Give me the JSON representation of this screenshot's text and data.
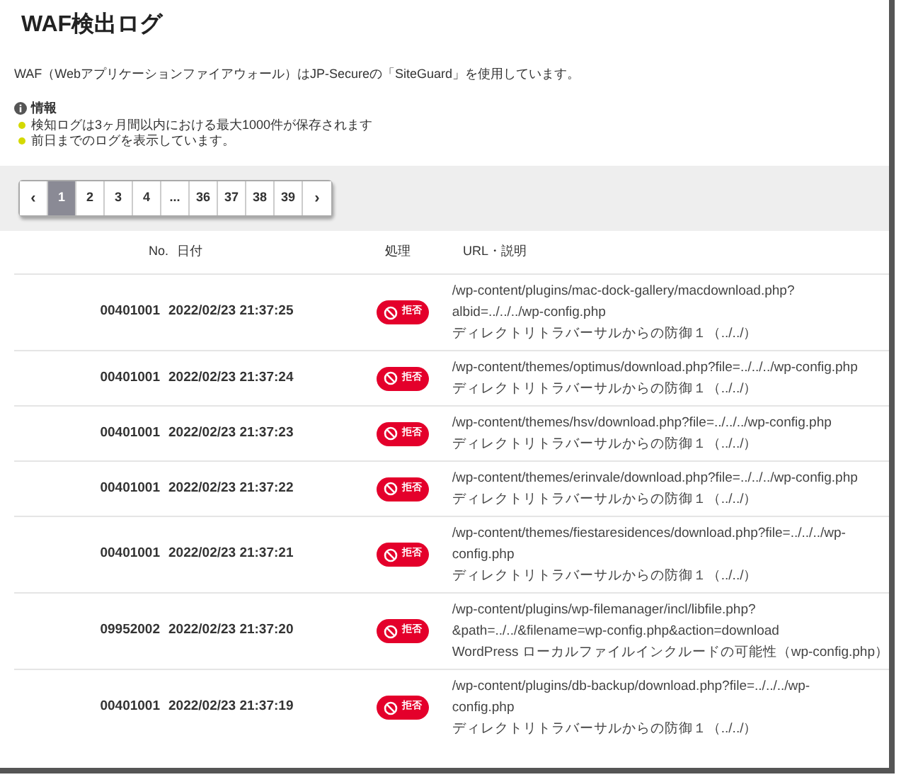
{
  "title": "WAF検出ログ",
  "description": "WAF（Webアプリケーションファイアウォール）はJP-Secureの「SiteGuard」を使用しています。",
  "info": {
    "heading": "情報",
    "items": [
      "検知ログは3ヶ月間以内における最大1000件が保存されます",
      "前日までのログを表示しています。"
    ]
  },
  "pagination": {
    "prev": "‹",
    "next": "›",
    "pages": [
      {
        "label": "1",
        "selected": true
      },
      {
        "label": "2",
        "selected": false
      },
      {
        "label": "3",
        "selected": false
      },
      {
        "label": "4",
        "selected": false
      },
      {
        "label": "...",
        "selected": false
      },
      {
        "label": "36",
        "selected": false
      },
      {
        "label": "37",
        "selected": false
      },
      {
        "label": "38",
        "selected": false
      },
      {
        "label": "39",
        "selected": false
      }
    ]
  },
  "table": {
    "columns": [
      "No.",
      "日付",
      "処理",
      "URL・説明"
    ],
    "rows": [
      {
        "no": "00401001",
        "date": "2022/02/23 21:37:25",
        "action": "拒否",
        "url": [
          "/wp-content/plugins/mac-dock-gallery/macdownload.php?",
          "albid=../../../wp-config.php"
        ],
        "note": "ディレクトリトラバーサルからの防御１（../../）"
      },
      {
        "no": "00401001",
        "date": "2022/02/23 21:37:24",
        "action": "拒否",
        "url": [
          "/wp-content/themes/optimus/download.php?file=../../../wp-config.php"
        ],
        "note": "ディレクトリトラバーサルからの防御１（../../）"
      },
      {
        "no": "00401001",
        "date": "2022/02/23 21:37:23",
        "action": "拒否",
        "url": [
          "/wp-content/themes/hsv/download.php?file=../../../wp-config.php"
        ],
        "note": "ディレクトリトラバーサルからの防御１（../../）"
      },
      {
        "no": "00401001",
        "date": "2022/02/23 21:37:22",
        "action": "拒否",
        "url": [
          "/wp-content/themes/erinvale/download.php?file=../../../wp-config.php"
        ],
        "note": "ディレクトリトラバーサルからの防御１（../../）"
      },
      {
        "no": "00401001",
        "date": "2022/02/23 21:37:21",
        "action": "拒否",
        "url": [
          "/wp-content/themes/fiestaresidences/download.php?file=../../../wp-",
          "config.php"
        ],
        "note": "ディレクトリトラバーサルからの防御１（../../）"
      },
      {
        "no": "09952002",
        "date": "2022/02/23 21:37:20",
        "action": "拒否",
        "url": [
          "/wp-content/plugins/wp-filemanager/incl/libfile.php?",
          "&path=../../&filename=wp-config.php&action=download"
        ],
        "note": "WordPress ローカルファイルインクルードの可能性（wp-config.php）"
      },
      {
        "no": "00401001",
        "date": "2022/02/23 21:37:19",
        "action": "拒否",
        "url": [
          "/wp-content/plugins/db-backup/download.php?file=../../../wp-",
          "config.php"
        ],
        "note": "ディレクトリトラバーサルからの防御１（../../）"
      }
    ]
  }
}
